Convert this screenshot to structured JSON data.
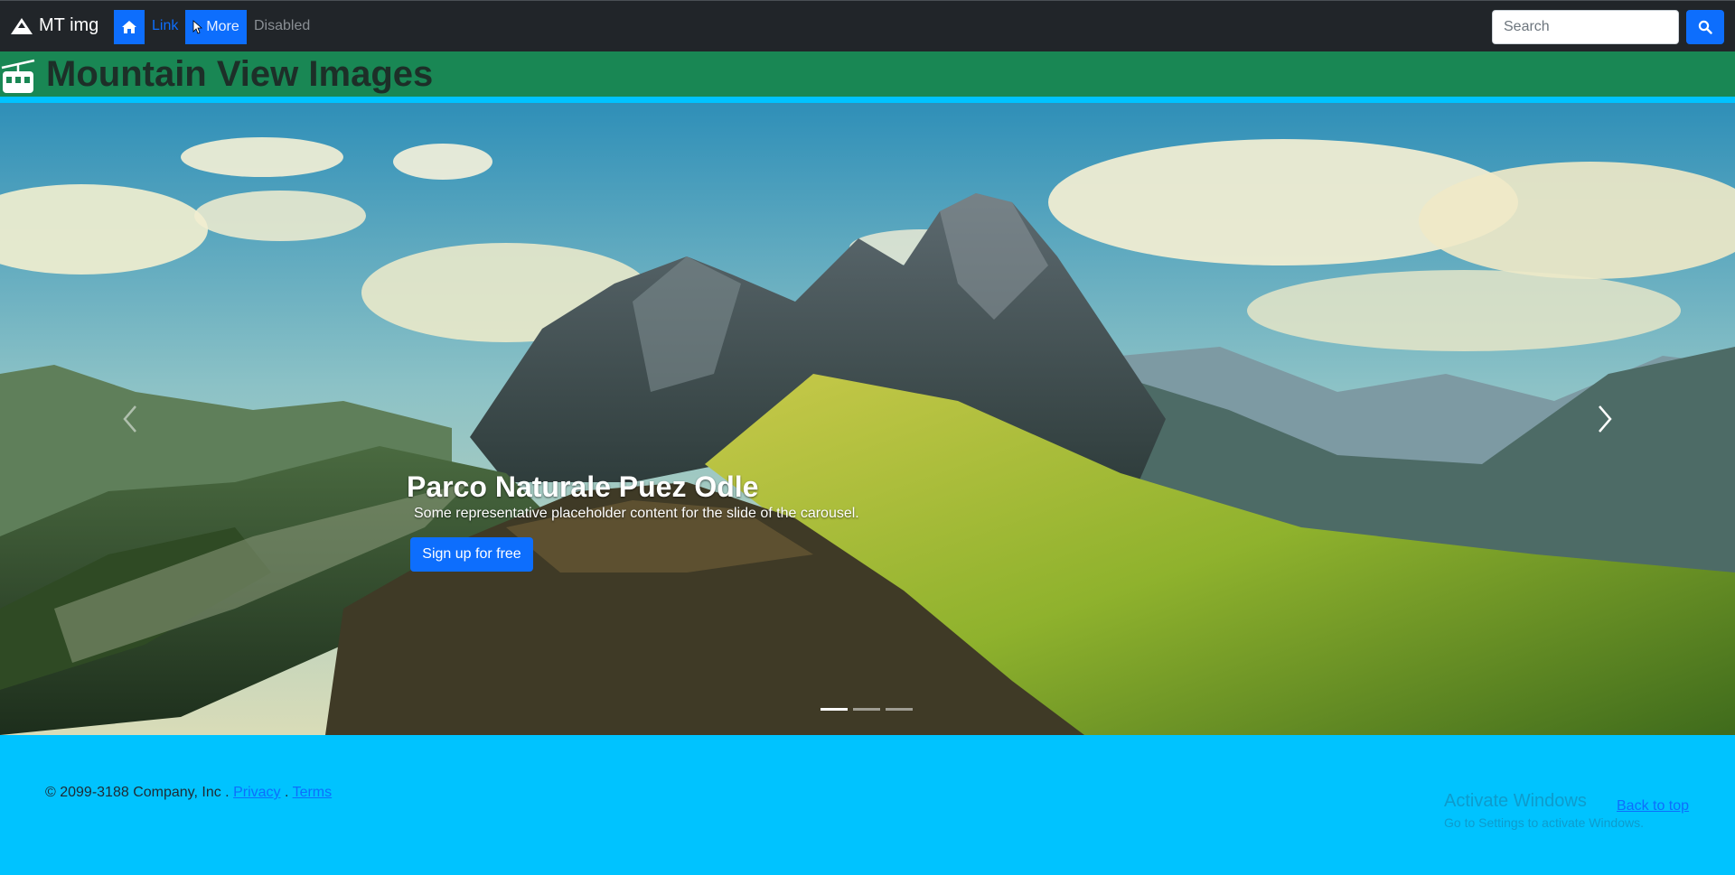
{
  "navbar": {
    "brand": "MT img",
    "home_icon": "home-icon",
    "link_label": "Link",
    "more_label": "More",
    "disabled_label": "Disabled",
    "search_placeholder": "Search",
    "search_button_icon": "search-icon"
  },
  "header": {
    "title": "Mountain View Images",
    "icon": "cable-car-icon"
  },
  "carousel": {
    "slide_title": "Parco Naturale Puez Odle",
    "slide_text": "Some representative placeholder content for the slide of the carousel.",
    "cta_label": "Sign up for free",
    "slide_count": 3,
    "active_slide": 1
  },
  "footer": {
    "copyright": "© 2099-3188 Company, Inc .",
    "separator": ".",
    "privacy_label": "Privacy",
    "terms_label": "Terms",
    "back_to_top_label": "Back to top",
    "watermark_title": "Activate Windows",
    "watermark_text": "Go to Settings to activate Windows."
  },
  "colors": {
    "navbar_bg": "#212529",
    "primary": "#0d6efd",
    "header_green": "#198754",
    "accent_cyan": "#00c3ff"
  }
}
